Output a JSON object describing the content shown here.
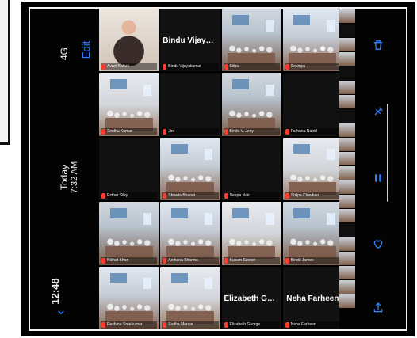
{
  "photo": {
    "status": {
      "carrier": "4G",
      "edit": "Edit",
      "date": "Today",
      "time": "7:32 AM",
      "clock": "12:48"
    },
    "gallery": {
      "tiles": [
        {
          "label": "Avani Kalani",
          "scene": "portrait",
          "active": true
        },
        {
          "label": "Bindu Vijayakumar",
          "scene": "name-only",
          "centerName": "Bindu Vijayaku..."
        },
        {
          "label": "Sitha",
          "scene": "alt1"
        },
        {
          "label": "Soumya",
          "scene": "alt2"
        },
        {
          "label": "Sindhu Kumar",
          "scene": "alt3"
        },
        {
          "label": "Jini",
          "scene": "dark"
        },
        {
          "label": "Bindu V. Jeny",
          "scene": "alt1"
        },
        {
          "label": "Farhana Nabid",
          "scene": "dark"
        },
        {
          "label": "Esther Silky",
          "scene": "dark"
        },
        {
          "label": "Shweta Bhanot",
          "scene": "alt2"
        },
        {
          "label": "Deepa Nair",
          "scene": "dark"
        },
        {
          "label": "Shilpa Chavhan",
          "scene": "alt3"
        },
        {
          "label": "Nikhat Khan",
          "scene": "alt1"
        },
        {
          "label": "Archana Sharma",
          "scene": "alt2"
        },
        {
          "label": "Kusum Suresh",
          "scene": "alt3"
        },
        {
          "label": "Bindu James",
          "scene": "alt1"
        },
        {
          "label": "Reshma Sreekumar",
          "scene": "alt2"
        },
        {
          "label": "Sudha Menon",
          "scene": "alt3"
        },
        {
          "label": "Elizabeth George",
          "scene": "name-only",
          "centerName": "Elizabeth George"
        },
        {
          "label": "Neha Farheen",
          "scene": "name-only",
          "centerName": "Neha Farheen"
        }
      ]
    },
    "rightIcons": {
      "trash": "trash-icon",
      "pin": "pin-icon",
      "pause": "pause-icon",
      "heart": "heart-icon",
      "share": "share-icon"
    }
  }
}
